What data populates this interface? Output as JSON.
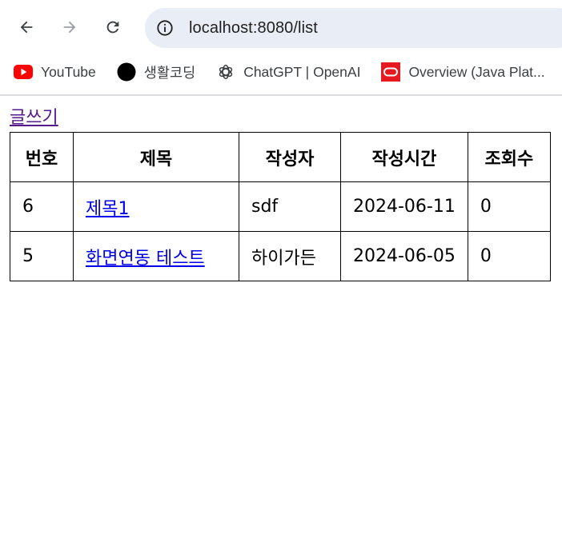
{
  "browser": {
    "url": "localhost:8080/list",
    "bookmarks": [
      {
        "label": "YouTube",
        "icon": "youtube-icon"
      },
      {
        "label": "생활코딩",
        "icon": "black-circle-icon"
      },
      {
        "label": "ChatGPT | OpenAI",
        "icon": "openai-icon"
      },
      {
        "label": "Overview (Java Plat...",
        "icon": "oracle-icon"
      }
    ]
  },
  "page": {
    "write_link": "글쓰기",
    "table": {
      "headers": [
        "번호",
        "제목",
        "작성자",
        "작성시간",
        "조회수"
      ],
      "rows": [
        {
          "no": "6",
          "title": "제목1",
          "writer": "sdf",
          "time": "2024-06-11",
          "views": "0"
        },
        {
          "no": "5",
          "title": "화면연동 테스트",
          "writer": "하이가든",
          "time": "2024-06-05",
          "views": "0"
        }
      ]
    }
  },
  "colors": {
    "visited_link": "#551a8b",
    "link": "#0000ee",
    "omnibox_bg": "#e9eef6",
    "youtube_red": "#ff0000",
    "oracle_red": "#e5191f"
  }
}
